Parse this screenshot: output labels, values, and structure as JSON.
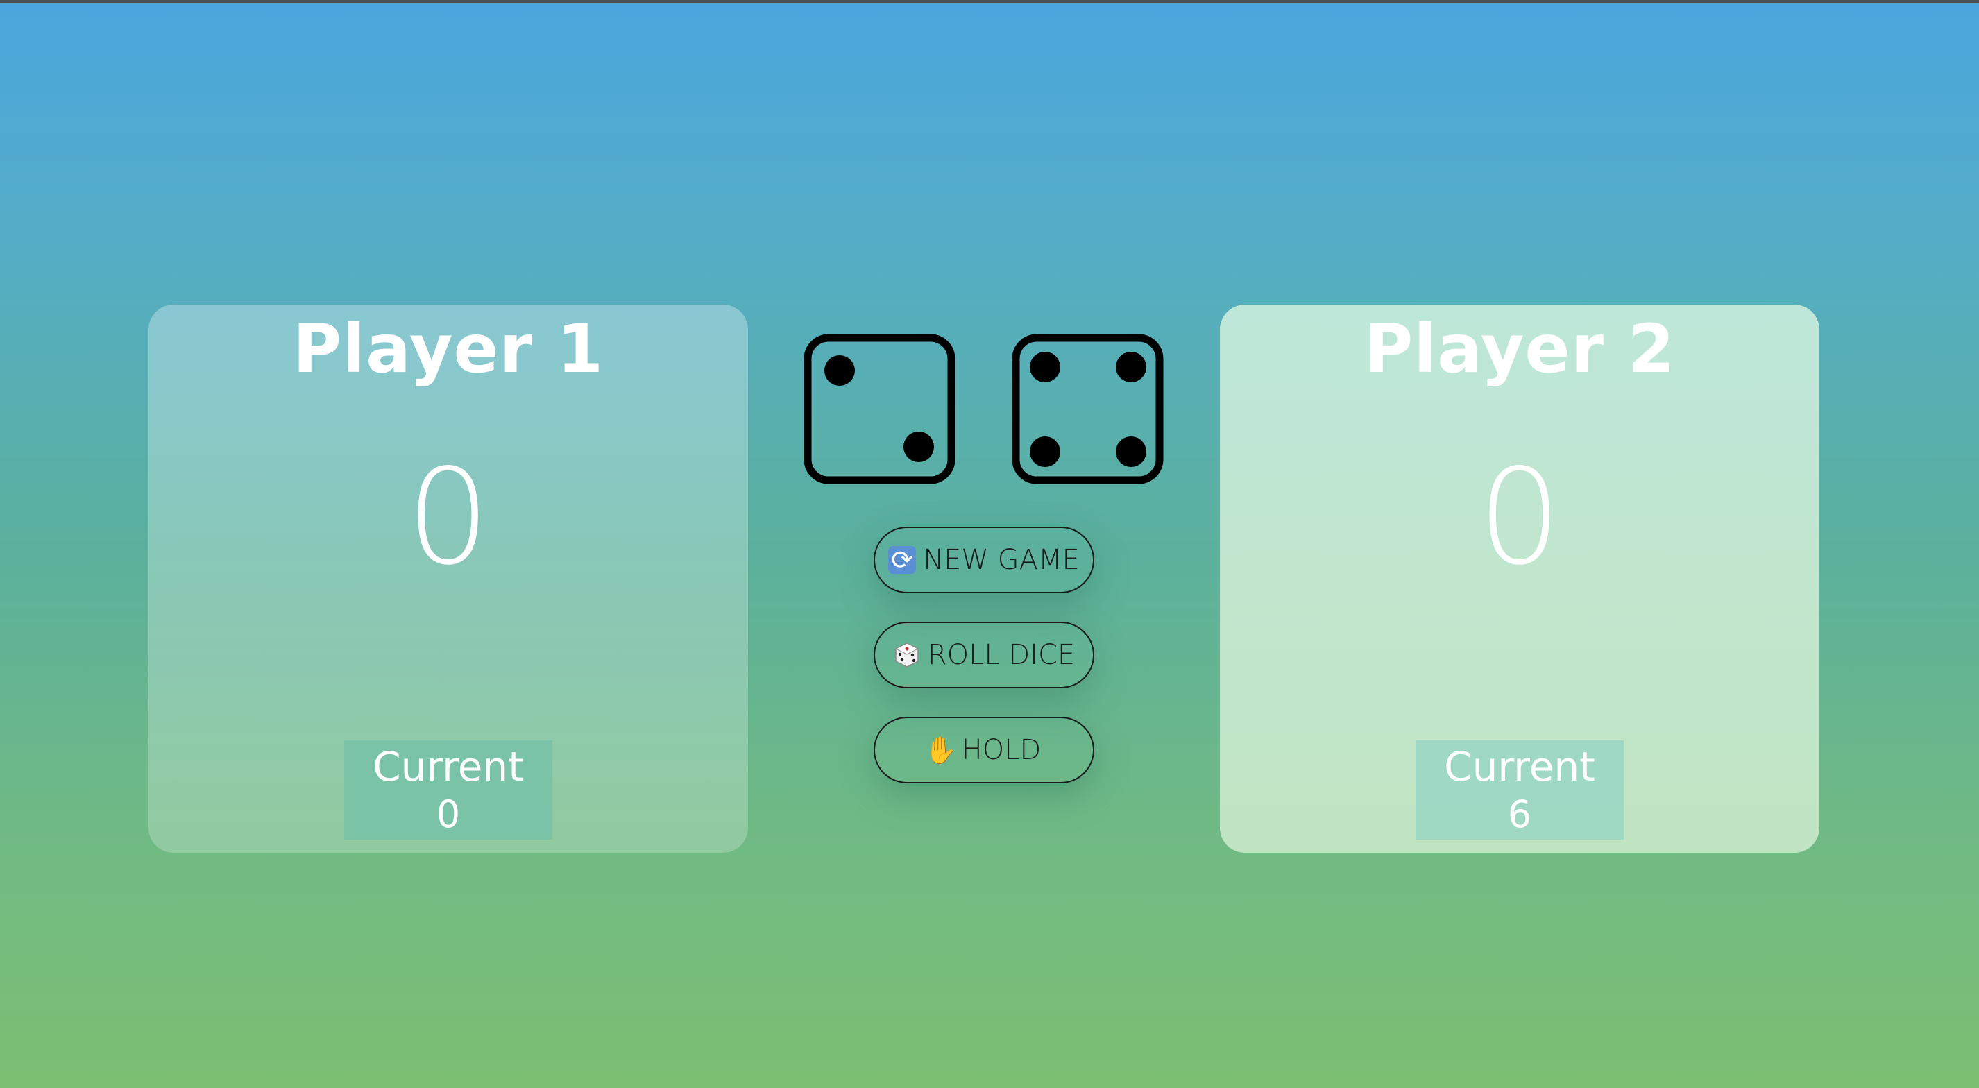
{
  "players": [
    {
      "name": "Player 1",
      "score": "0",
      "current_label": "Current",
      "current": "0"
    },
    {
      "name": "Player 2",
      "score": "0",
      "current_label": "Current",
      "current": "6"
    }
  ],
  "dice": [
    {
      "face": 2
    },
    {
      "face": 4
    }
  ],
  "buttons": {
    "new_game": {
      "icon": "refresh-icon",
      "glyph": "🔄",
      "label": "NEW GAME"
    },
    "roll_dice": {
      "icon": "dice-icon",
      "glyph": "🎲",
      "label": "ROLL DICE"
    },
    "hold": {
      "icon": "hand-icon",
      "glyph": "✋",
      "label": "HOLD"
    }
  },
  "colors": {
    "background_top": "#4ba6de",
    "background_bottom": "#7cbf72",
    "text": "#ffffff",
    "die_stroke": "#000000"
  }
}
